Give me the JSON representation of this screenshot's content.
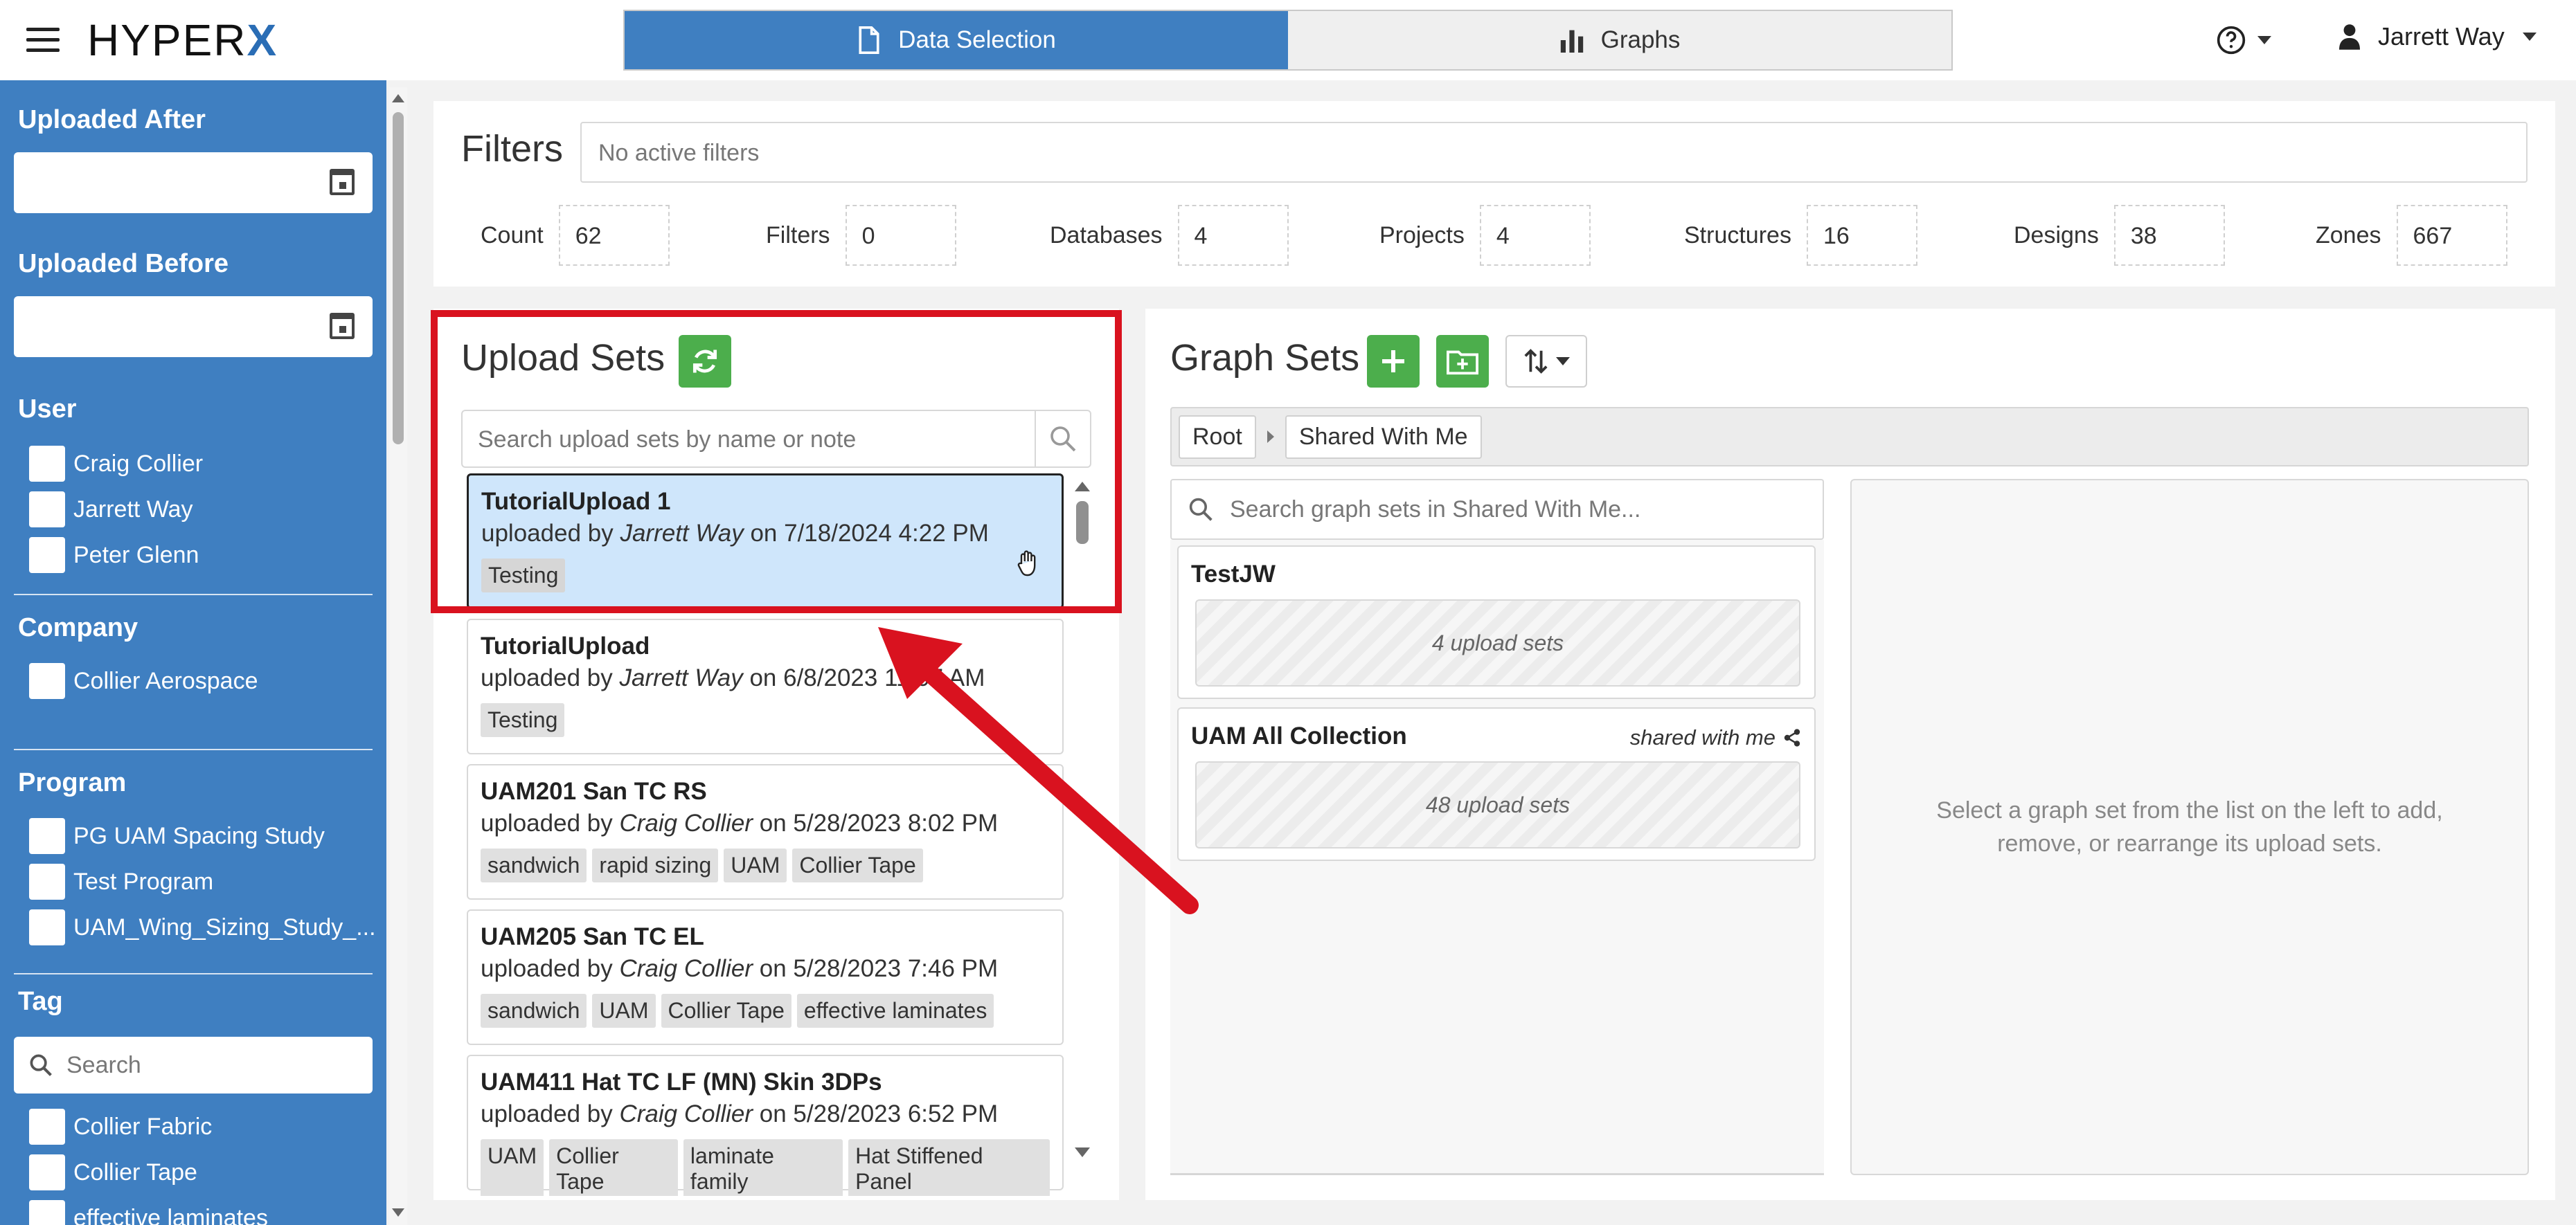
{
  "header": {
    "logo_text": "HYPER",
    "logo_x": "X",
    "tabs": [
      {
        "label": "Data Selection",
        "icon": "file-icon",
        "active": true
      },
      {
        "label": "Graphs",
        "icon": "bar-chart-icon",
        "active": false
      }
    ],
    "help_icon": "question-circle-icon",
    "user_name": "Jarrett Way"
  },
  "sidebar": {
    "uploaded_after": {
      "label": "Uploaded After",
      "value": ""
    },
    "uploaded_before": {
      "label": "Uploaded Before",
      "value": ""
    },
    "user": {
      "label": "User",
      "options": [
        "Craig Collier",
        "Jarrett Way",
        "Peter Glenn"
      ]
    },
    "company": {
      "label": "Company",
      "options": [
        "Collier Aerospace"
      ]
    },
    "program": {
      "label": "Program",
      "options": [
        "PG UAM Spacing Study",
        "Test Program",
        "UAM_Wing_Sizing_Study_..."
      ]
    },
    "tag": {
      "label": "Tag",
      "search_placeholder": "Search",
      "options": [
        "Collier Fabric",
        "Collier Tape",
        "effective laminates"
      ]
    }
  },
  "filters": {
    "title": "Filters",
    "placeholder": "No active filters",
    "stats": [
      {
        "label": "Count",
        "value": "62"
      },
      {
        "label": "Filters",
        "value": "0"
      },
      {
        "label": "Databases",
        "value": "4"
      },
      {
        "label": "Projects",
        "value": "4"
      },
      {
        "label": "Structures",
        "value": "16"
      },
      {
        "label": "Designs",
        "value": "38"
      },
      {
        "label": "Zones",
        "value": "667"
      }
    ]
  },
  "upload_sets": {
    "title": "Upload Sets",
    "search_placeholder": "Search upload sets by name or note",
    "items": [
      {
        "name": "TutorialUpload 1",
        "prefix": "uploaded by ",
        "user": "Jarrett Way",
        "date": " on 7/18/2024 4:22 PM",
        "tags": [
          "Testing"
        ],
        "selected": true
      },
      {
        "name": "TutorialUpload",
        "prefix": "uploaded by ",
        "user": "Jarrett Way",
        "date": " on 6/8/2023 11:07 AM",
        "tags": [
          "Testing"
        ],
        "selected": false
      },
      {
        "name": "UAM201 San TC RS",
        "prefix": "uploaded by ",
        "user": "Craig Collier",
        "date": " on 5/28/2023 8:02 PM",
        "tags": [
          "sandwich",
          "rapid sizing",
          "UAM",
          "Collier Tape"
        ],
        "selected": false
      },
      {
        "name": "UAM205 San TC EL",
        "prefix": "uploaded by ",
        "user": "Craig Collier",
        "date": " on 5/28/2023 7:46 PM",
        "tags": [
          "sandwich",
          "UAM",
          "Collier Tape",
          "effective laminates"
        ],
        "selected": false
      },
      {
        "name": "UAM411 Hat TC LF (MN) Skin 3DPs",
        "prefix": "uploaded by ",
        "user": "Craig Collier",
        "date": " on 5/28/2023 6:52 PM",
        "tags": [
          "UAM",
          "Collier Tape",
          "laminate family",
          "Hat Stiffened Panel"
        ],
        "selected": false
      }
    ]
  },
  "graph_sets": {
    "title": "Graph Sets",
    "breadcrumb": [
      "Root",
      "Shared With Me"
    ],
    "search_placeholder": "Search graph sets in Shared With Me...",
    "sets": [
      {
        "name": "TestJW",
        "count": "4 upload sets",
        "shared": ""
      },
      {
        "name": "UAM All Collection",
        "count": "48 upload sets",
        "shared": "shared with me"
      }
    ],
    "detail_text": "Select a graph set from the list on the left to add, remove, or rearrange its upload sets."
  },
  "colors": {
    "primary": "#3f7fc1",
    "success": "#4cae4c",
    "highlight": "#d9121f",
    "selected_bg": "#cfe6fb"
  }
}
